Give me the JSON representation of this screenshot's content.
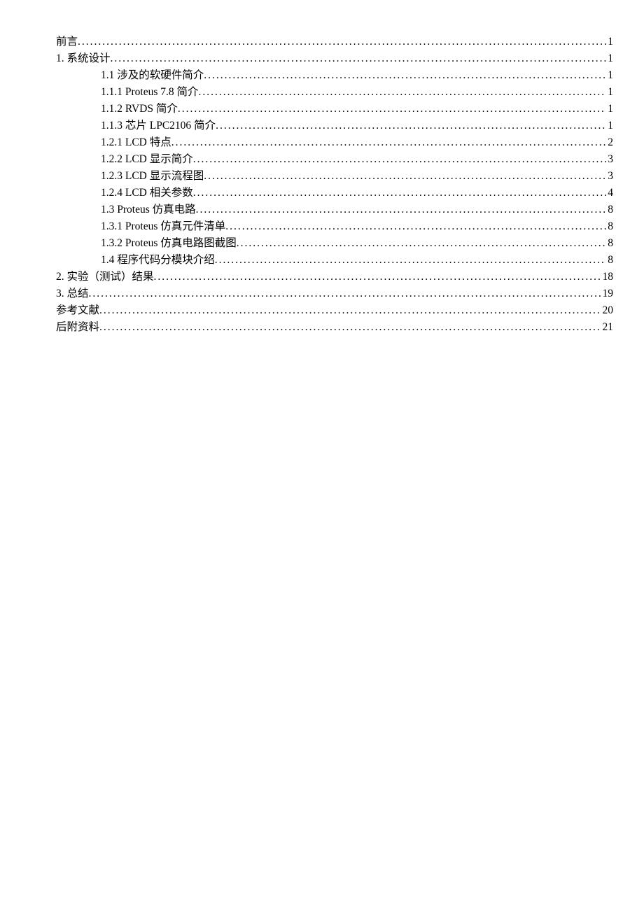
{
  "toc": [
    {
      "indent": 0,
      "label": "前言",
      "page": "1"
    },
    {
      "indent": 0,
      "label": "1. 系统设计",
      "page": "1"
    },
    {
      "indent": 1,
      "label": "1.1 涉及的软硬件简介 ",
      "page": "1"
    },
    {
      "indent": 1,
      "label": "1.1.1 Proteus 7.8 简介 ",
      "page": "1"
    },
    {
      "indent": 1,
      "label": "1.1.2 RVDS 简介 ",
      "page": "1"
    },
    {
      "indent": 1,
      "label": "1.1.3 芯片 LPC2106 简介",
      "page": "1"
    },
    {
      "indent": 1,
      "label": "1.2.1 LCD 特点 ",
      "page": "2"
    },
    {
      "indent": 1,
      "label": "1.2.2 LCD 显示简介 ",
      "page": "3"
    },
    {
      "indent": 1,
      "label": "1.2.3 LCD 显示流程图 ",
      "page": "3"
    },
    {
      "indent": 1,
      "label": "1.2.4 LCD 相关参数 ",
      "page": "4"
    },
    {
      "indent": 1,
      "label": "1.3  Proteus 仿真电路 ",
      "page": "8"
    },
    {
      "indent": 1,
      "label": "1.3.1 Proteus 仿真元件清单 ",
      "page": "8"
    },
    {
      "indent": 1,
      "label": "1.3.2 Proteus 仿真电路图截图 ",
      "page": "8"
    },
    {
      "indent": 1,
      "label": "1.4 程序代码分模块介绍",
      "page": "8"
    },
    {
      "indent": 0,
      "label": "2. 实验（测试）结果",
      "page": "18"
    },
    {
      "indent": 0,
      "label": "3. 总结",
      "page": "19"
    },
    {
      "indent": 0,
      "label": "参考文献",
      "page": "20"
    },
    {
      "indent": 0,
      "label": "后附资料",
      "page": "21"
    }
  ]
}
